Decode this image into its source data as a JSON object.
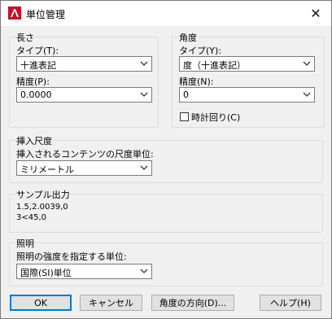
{
  "window": {
    "title": "単位管理",
    "close_glyph": "✕"
  },
  "length": {
    "group_title": "長さ",
    "type_label": "タイプ(T):",
    "type_value": "十進表記",
    "precision_label": "精度(P):",
    "precision_value": "0.0000"
  },
  "angle": {
    "group_title": "角度",
    "type_label": "タイプ(Y):",
    "type_value": "度（十進表記）",
    "precision_label": "精度(N):",
    "precision_value": "0",
    "clockwise_label": "時計回り(C)",
    "clockwise_checked": false
  },
  "insert_scale": {
    "group_title": "挿入尺度",
    "unit_label": "挿入されるコンテンツの尺度単位:",
    "unit_value": "ミリメートル"
  },
  "sample_output": {
    "group_title": "サンプル出力",
    "line1": "1.5,2.0039,0",
    "line2": "3<45,0"
  },
  "lighting": {
    "group_title": "照明",
    "unit_label": "照明の強度を指定する単位:",
    "unit_value": "国際(SI)単位"
  },
  "buttons": {
    "ok": "OK",
    "cancel": "キャンセル",
    "direction": "角度の方向(D)...",
    "help": "ヘルプ(H)"
  },
  "colors": {
    "app_icon_red": "#c8102e",
    "default_button_border": "#0078d7"
  }
}
